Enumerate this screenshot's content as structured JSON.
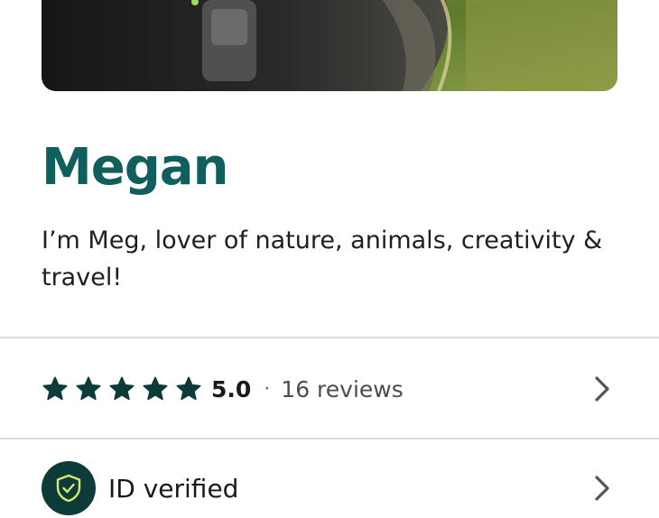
{
  "profile": {
    "name": "Megan",
    "bio": "I’m Meg, lover of nature, animals, creativity & travel!"
  },
  "rating": {
    "stars": 5,
    "value": "5.0",
    "separator": "·",
    "reviews": "16 reviews"
  },
  "verification": {
    "label": "ID verified"
  },
  "colors": {
    "name_accent": "#0e5f5d",
    "star": "#0d3b3a",
    "badge_bg": "#0d3b3a",
    "badge_icon": "#d7e86a"
  },
  "icons": {
    "star": "star-icon",
    "chevron": "chevron-right-icon",
    "shield": "shield-check-icon"
  }
}
